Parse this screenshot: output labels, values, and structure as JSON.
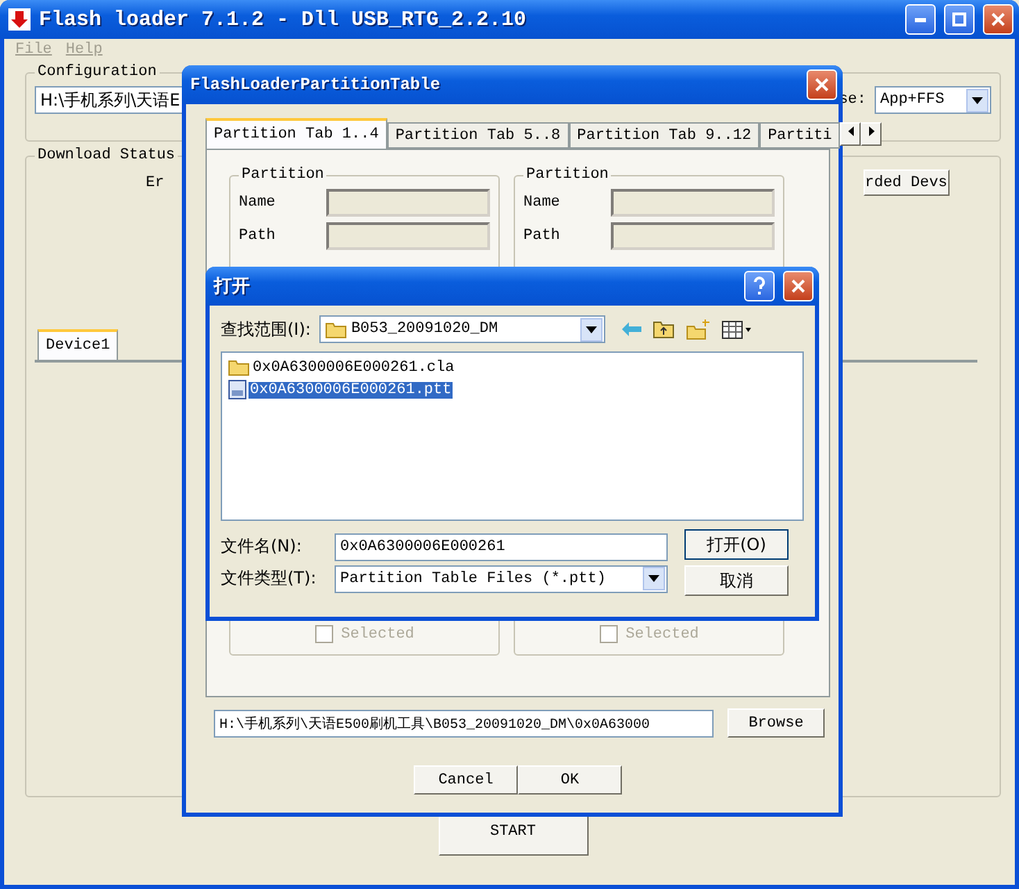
{
  "main_window": {
    "title": "Flash loader 7.1.2 - Dll USB_RTG_2.2.10",
    "menu": [
      {
        "label": "File",
        "disabled": true
      },
      {
        "label": "Help",
        "disabled": true
      }
    ],
    "configuration": {
      "label": "Configuration",
      "path": "H:\\手机系列\\天语E",
      "mode_label": "se:",
      "mode": "App+FFS"
    },
    "download_status": {
      "label": "Download Status",
      "column_label": "Er",
      "devices_button": "rded Devs",
      "tabs": [
        {
          "label": "Device1",
          "selected": true
        }
      ]
    },
    "start_button": "START"
  },
  "partition_dialog": {
    "title": "FlashLoaderPartitionTable",
    "tabs": [
      {
        "label": "Partition Tab 1..4",
        "selected": true
      },
      {
        "label": "Partition Tab 5..8",
        "selected": false
      },
      {
        "label": "Partition Tab 9..12",
        "selected": false
      },
      {
        "label": "Partiti",
        "selected": false
      }
    ],
    "partitions": [
      {
        "title": "Partition",
        "name_label": "Name",
        "path_label": "Path",
        "selected_label": "Selected",
        "checked": false,
        "disabled": true
      },
      {
        "title": "Partition",
        "name_label": "Name",
        "path_label": "Path",
        "selected_label": "Selected",
        "checked": false,
        "disabled": true
      }
    ],
    "path": "H:\\手机系列\\天语E500刷机工具\\B053_20091020_DM\\0x0A63000",
    "browse_button": "Browse",
    "buttons": [
      {
        "label": "Cancel"
      },
      {
        "label": "OK"
      }
    ]
  },
  "open_dialog": {
    "title": "打开",
    "look_in_label": "查找范围(I):",
    "look_in": "B053_20091020_DM",
    "files": [
      {
        "name": "0x0A6300006E000261.cla",
        "kind": "folder",
        "selected": false
      },
      {
        "name": "0x0A6300006E000261.ptt",
        "kind": "file",
        "selected": true
      }
    ],
    "file_name_label": "文件名(N):",
    "file_name": "0x0A6300006E000261",
    "file_type_label": "文件类型(T):",
    "file_type": "Partition Table Files (*.ptt)",
    "open_button": "打开(O)",
    "cancel_button": "取消"
  }
}
